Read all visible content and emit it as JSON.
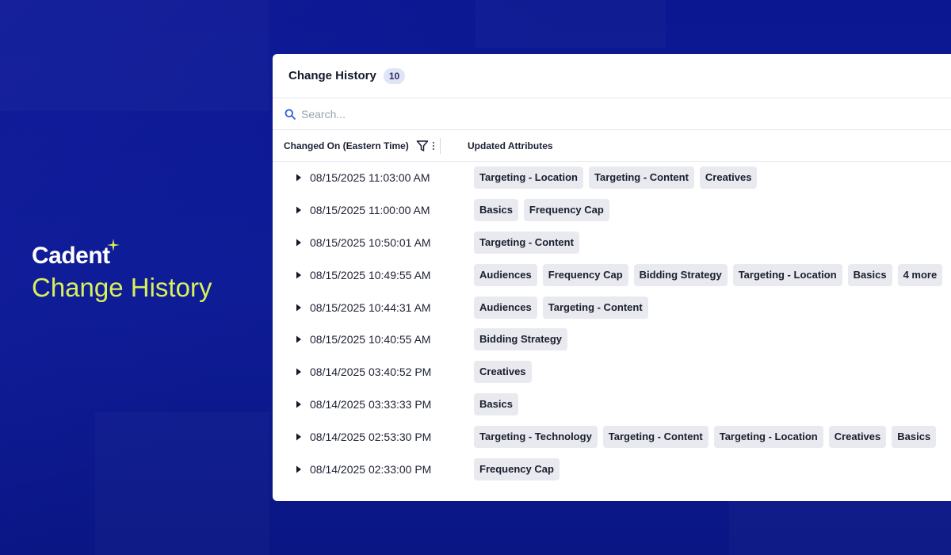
{
  "brand": {
    "logo": "Cadent",
    "title": "Change History",
    "accent_color": "#d8f05a"
  },
  "panel": {
    "title": "Change History",
    "count": "10",
    "search_placeholder": "Search...",
    "columns": {
      "date": "Changed On (Eastern Time)",
      "attributes": "Updated Attributes"
    },
    "rows": [
      {
        "date": "08/15/2025 11:03:00 AM",
        "tags": [
          "Targeting - Location",
          "Targeting - Content",
          "Creatives"
        ]
      },
      {
        "date": "08/15/2025 11:00:00 AM",
        "tags": [
          "Basics",
          "Frequency Cap"
        ]
      },
      {
        "date": "08/15/2025 10:50:01 AM",
        "tags": [
          "Targeting - Content"
        ]
      },
      {
        "date": "08/15/2025 10:49:55 AM",
        "tags": [
          "Audiences",
          "Frequency Cap",
          "Bidding Strategy",
          "Targeting - Location",
          "Basics",
          "4 more"
        ]
      },
      {
        "date": "08/15/2025 10:44:31 AM",
        "tags": [
          "Audiences",
          "Targeting - Content"
        ]
      },
      {
        "date": "08/15/2025 10:40:55 AM",
        "tags": [
          "Bidding Strategy"
        ]
      },
      {
        "date": "08/14/2025 03:40:52 PM",
        "tags": [
          "Creatives"
        ]
      },
      {
        "date": "08/14/2025 03:33:33 PM",
        "tags": [
          "Basics"
        ]
      },
      {
        "date": "08/14/2025 02:53:30 PM",
        "tags": [
          "Targeting - Technology",
          "Targeting - Content",
          "Targeting - Location",
          "Creatives",
          "Basics"
        ]
      },
      {
        "date": "08/14/2025 02:33:00 PM",
        "tags": [
          "Frequency Cap"
        ]
      }
    ]
  },
  "icons": {
    "search": "search-icon",
    "filter": "filter-icon",
    "column_menu": "kebab-menu-icon",
    "expand": "caret-right-icon",
    "sparkle": "sparkle-icon"
  }
}
